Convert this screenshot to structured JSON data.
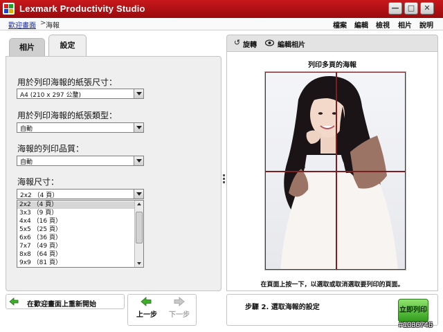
{
  "window": {
    "title": "Lexmark Productivity Studio",
    "minimize_glyph": "—",
    "maximize_glyph": "□",
    "close_glyph": "✕"
  },
  "breadcrumb": {
    "home": "歡迎畫面",
    "separator": ">",
    "current": "海報"
  },
  "menu": {
    "items": [
      "檔案",
      "編輯",
      "檢視",
      "相片",
      "說明"
    ]
  },
  "tabs": {
    "photo": "相片",
    "settings": "設定"
  },
  "settings": {
    "paper_size_label": "用於列印海報的紙張尺寸：",
    "paper_size_value": "A4 (210 x 297 公釐)",
    "paper_type_label": "用於列印海報的紙張類型：",
    "paper_type_value": "自動",
    "print_quality_label": "海報的列印品質：",
    "print_quality_value": "自動",
    "poster_size_label": "海報尺寸：",
    "poster_size_value": "2x2 （4 頁）",
    "poster_size_options": [
      "2x2 （4 頁）",
      "3x3 （9 頁）",
      "4x4 （16 頁）",
      "5x5 （25 頁）",
      "6x6 （36 頁）",
      "7x7 （49 頁）",
      "8x8 （64 頁）",
      "9x9 （81 頁）"
    ],
    "selected_option_index": 0
  },
  "preview_toolbar": {
    "rotate": "旋轉",
    "edit_photo": "編輯相片"
  },
  "preview": {
    "title": "列印多頁的海報",
    "hint": "在頁面上按一下，以選取或取消選取要列印的頁面。",
    "grid_columns": 2,
    "grid_rows": 2
  },
  "footer": {
    "restart": "在歡迎畫面上重新開始",
    "prev": "上一步",
    "next": "下一步",
    "step": "步驟 2. 選取海報的設定",
    "print_now": "立即列印"
  },
  "watermark": "#1036746",
  "colors": {
    "title_bar": "#b01216",
    "accent_green": "#2f9b1c",
    "grid_line": "#7a1f22"
  },
  "icons": {
    "rotate": "rotate-icon",
    "edit_photo": "eye-icon",
    "restart": "back-arrow-icon",
    "prev": "prev-arrow-icon",
    "next": "next-arrow-icon"
  }
}
